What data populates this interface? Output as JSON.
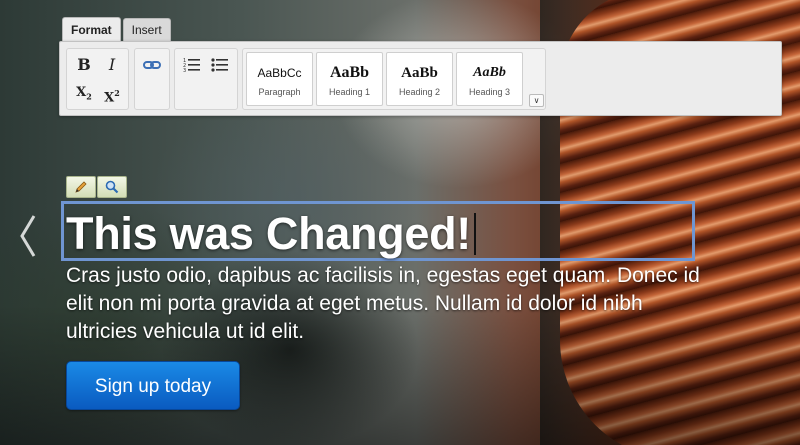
{
  "editor": {
    "tabs": [
      {
        "label": "Format",
        "active": true
      },
      {
        "label": "Insert",
        "active": false
      }
    ],
    "toolbar": {
      "bold_label": "B",
      "italic_label": "I",
      "subscript_label": "X",
      "superscript_label": "X",
      "subscript_mark": "2",
      "superscript_mark": "2",
      "link_icon": "link-icon",
      "ordered_list_icon": "ordered-list-icon",
      "unordered_list_icon": "unordered-list-icon",
      "styles": [
        {
          "sample": "AaBbCc",
          "caption": "Paragraph"
        },
        {
          "sample": "AaBb",
          "caption": "Heading 1"
        },
        {
          "sample": "AaBb",
          "caption": "Heading 2"
        },
        {
          "sample": "AaBb",
          "caption": "Heading 3"
        }
      ],
      "more_icon": "chevron-double-down-icon"
    },
    "mini_buttons": [
      "pencil-icon",
      "magnifier-icon"
    ]
  },
  "hero": {
    "headline": "This was Changed!",
    "body": "Cras justo odio, dapibus ac facilisis in, egestas eget quam. Donec id elit non mi porta gravida at eget metus. Nullam id dolor id nibh ultricies vehicula ut id elit.",
    "cta_label": "Sign up today",
    "prev_icon": "chevron-left-icon"
  },
  "colors": {
    "selection_border": "#6f95d1",
    "cta_top": "#1a8ae6",
    "cta_bottom": "#0a5bc0"
  }
}
